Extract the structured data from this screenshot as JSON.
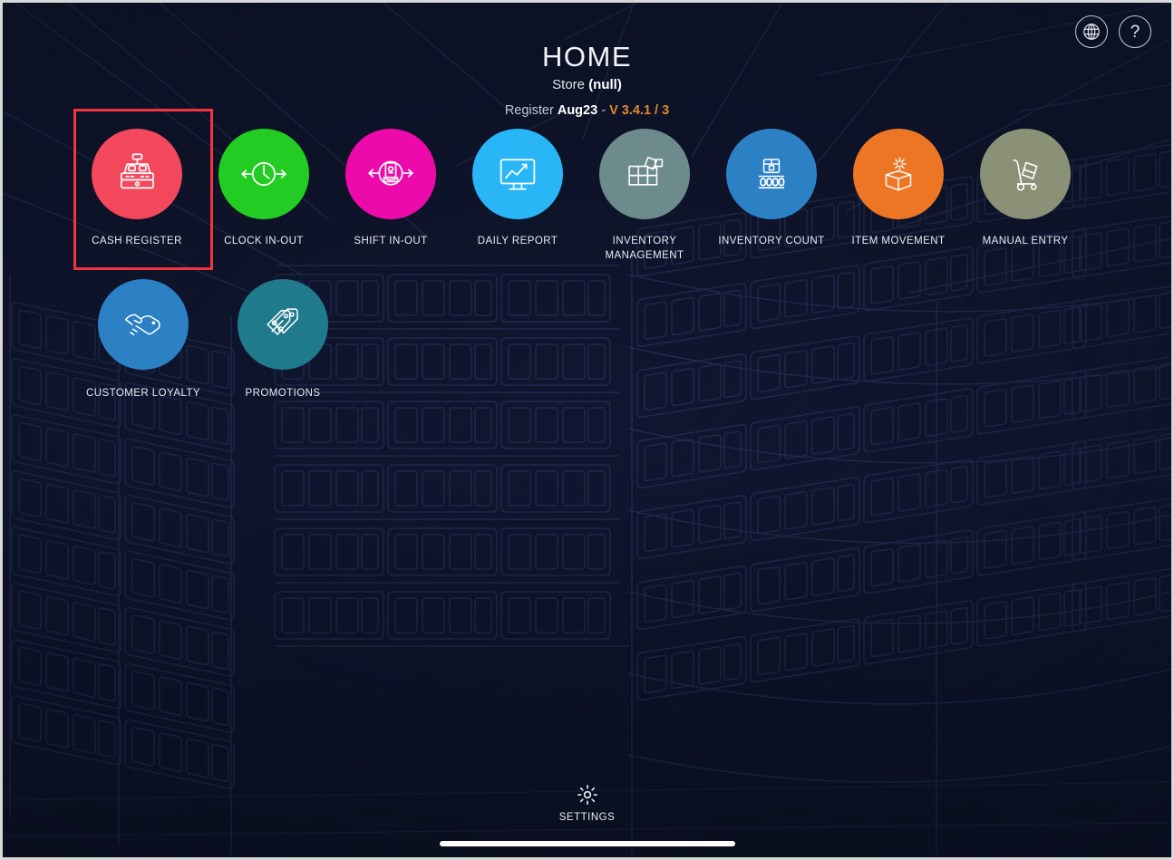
{
  "header": {
    "title": "HOME",
    "store_label": "Store",
    "store_value": "(null)",
    "register_label": "Register",
    "register_name": "Aug23",
    "separator": "-",
    "version": "V 3.4.1 / 3",
    "icons": [
      {
        "name": "globe-icon",
        "glyph": "globe"
      },
      {
        "name": "help-icon",
        "glyph": "?"
      }
    ]
  },
  "colors": {
    "background": "#0d1326",
    "highlight": "#f5333f",
    "version_text": "#e08a2e",
    "label_text": "#e9ecf4",
    "cash_register": "#f3485b",
    "clock_in_out": "#22cc22",
    "shift_in_out": "#ec0aaa",
    "daily_report": "#29b6f6",
    "inventory_management": "#6d8a8c",
    "inventory_count": "#2c80c4",
    "item_movement": "#ec7624",
    "manual_entry": "#8a9177",
    "customer_loyalty": "#2c80c4",
    "promotions": "#1f7a8c"
  },
  "tiles": {
    "row1": [
      {
        "id": "cash-register",
        "label": "CASH REGISTER",
        "color": "#f3485b",
        "icon": "cash-register-icon",
        "highlighted": true
      },
      {
        "id": "clock-in-out",
        "label": "CLOCK IN-OUT",
        "color": "#22cc22",
        "icon": "clock-arrows-icon",
        "highlighted": false
      },
      {
        "id": "shift-in-out",
        "label": "SHIFT IN-OUT",
        "color": "#ec0aaa",
        "icon": "cash-hand-arrows-icon",
        "highlighted": false
      },
      {
        "id": "daily-report",
        "label": "DAILY REPORT",
        "color": "#29b6f6",
        "icon": "monitor-chart-icon",
        "highlighted": false
      },
      {
        "id": "inventory-management",
        "label": "INVENTORY MANAGEMENT",
        "color": "#6d8a8c",
        "icon": "box-grid-icon",
        "highlighted": false
      },
      {
        "id": "inventory-count",
        "label": "INVENTORY COUNT",
        "color": "#2c80c4",
        "icon": "box-counter-icon",
        "highlighted": false
      },
      {
        "id": "item-movement",
        "label": "ITEM MOVEMENT",
        "color": "#ec7624",
        "icon": "box-gear-icon",
        "highlighted": false
      },
      {
        "id": "manual-entry",
        "label": "MANUAL ENTRY",
        "color": "#8a9177",
        "icon": "hand-truck-icon",
        "highlighted": false
      }
    ],
    "row2": [
      {
        "id": "customer-loyalty",
        "label": "CUSTOMER LOYALTY",
        "color": "#2c80c4",
        "icon": "handshake-icon",
        "highlighted": false
      },
      {
        "id": "promotions",
        "label": "PROMOTIONS",
        "color": "#1f7a8c",
        "icon": "price-tags-icon",
        "highlighted": false
      }
    ]
  },
  "footer": {
    "settings_label": "SETTINGS",
    "settings_icon": "gear-icon"
  }
}
